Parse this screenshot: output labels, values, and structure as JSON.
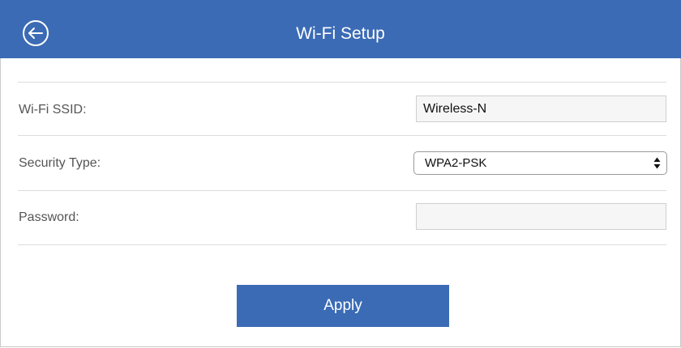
{
  "header": {
    "title": "Wi-Fi Setup",
    "back_icon": "arrow-left-circle-icon"
  },
  "form": {
    "ssid": {
      "label": "Wi-Fi SSID:",
      "value": "Wireless-N"
    },
    "security": {
      "label": "Security Type:",
      "value": "WPA2-PSK",
      "icon": "up-down-arrows-icon"
    },
    "password": {
      "label": "Password:",
      "value": ""
    }
  },
  "actions": {
    "apply_label": "Apply"
  },
  "colors": {
    "accent": "#3b6bb5",
    "field_background": "#f6f6f6",
    "label_text": "#555555",
    "divider": "#dcdcdc"
  }
}
